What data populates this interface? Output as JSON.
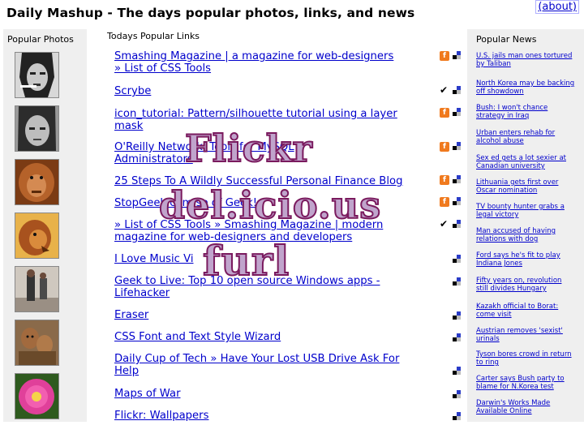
{
  "header": {
    "title": "Daily Mashup - The days popular photos, links, and news",
    "about_label": "(about)"
  },
  "photos": {
    "heading": "Popular Photos"
  },
  "links": {
    "heading": "Todays Popular Links",
    "items": [
      {
        "text": "Smashing Magazine | a magazine for web-designers\n» List of CSS Tools",
        "marker": "f"
      },
      {
        "text": "Scrybe",
        "marker": "check"
      },
      {
        "text": "icon_tutorial: Pattern/silhouette tutorial using a layer\nmask",
        "marker": "f"
      },
      {
        "text": "O'Reilly Network:             Tools for MySQL\nAdministrators",
        "marker": "f"
      },
      {
        "text": "25 Steps To A Wildly Successful Personal Finance Blog",
        "marker": "f"
      },
      {
        "text": "StopGeek.com                      se of Geek!",
        "marker": "f"
      },
      {
        "text": "» List of CSS Tools » Smashing Magazine | modern\nmagazine for web-designers and developers",
        "marker": "check"
      },
      {
        "text": "I Love Music Vi",
        "marker": "del"
      },
      {
        "text": "Geek to Live: Top 10 open source Windows apps -\nLifehacker",
        "marker": "del"
      },
      {
        "text": "Eraser",
        "marker": "del"
      },
      {
        "text": "CSS Font and Text Style Wizard",
        "marker": "del"
      },
      {
        "text": "Daily Cup of Tech » Have Your Lost USB Drive Ask For\nHelp",
        "marker": "del"
      },
      {
        "text": "Maps of War",
        "marker": "del"
      },
      {
        "text": "Flickr: Wallpapers",
        "marker": "del"
      }
    ]
  },
  "news": {
    "heading": "Popular News",
    "items": [
      "U.S. jails man ones tortured\nby Taliban",
      "North Korea may be backing\noff showdown",
      "Bush: I won't chance\nstrategy in Iraq",
      "Urban enters rehab for\nalcohol abuse",
      "Sex ed gets a lot sexier at\nCanadian university",
      "Lithuania gets first over\nOscar nomination",
      "TV bounty hunter grabs a\nlegal victory",
      "Man accused of having\nrelations with dog",
      "Ford says he's fit to play\nIndiana Jones",
      "Fifty years on, revolution\nstill divides Hungary",
      "Kazakh official to Borat:\ncome visit",
      "Austrian removes 'sexist'\nurinals",
      "Tyson bores crowd in return\nto ring",
      "Carter says Bush party to\nblame for N.Korea test",
      "Darwin's Works Made\nAvailable Online"
    ]
  },
  "overlay": {
    "flickr": "Flickr",
    "delicious": "del.icio.us",
    "furl": "furl"
  },
  "colors": {
    "link": "#0000cc",
    "column_bg": "#efefef",
    "flickr_badge": "#f07a1e",
    "delicious_blue": "#2a3cc8",
    "overlay_fill": "#c0a4cc",
    "overlay_stroke": "#7a1a5e"
  },
  "icons": {
    "f": "flickr-f-badge-icon",
    "check": "checkmark-icon",
    "del": "delicious-squares-icon"
  }
}
